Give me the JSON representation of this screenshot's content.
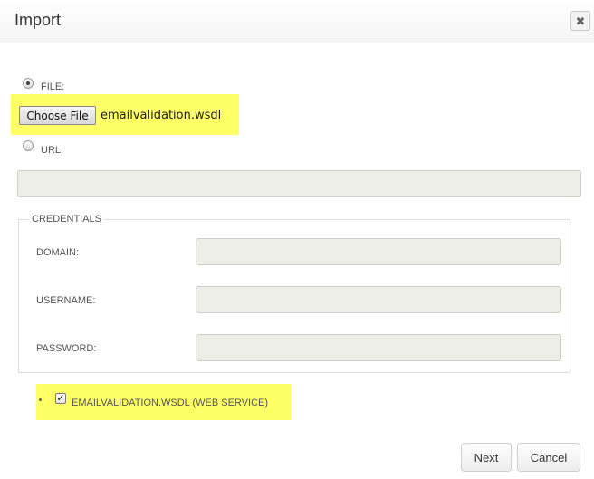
{
  "dialog": {
    "title": "Import",
    "close_icon": "close-icon"
  },
  "source": {
    "file_label": "FILE:",
    "file_selected": true,
    "choose_file_label": "Choose File",
    "file_name": "emailvalidation.wsdl",
    "url_label": "URL:",
    "url_value": ""
  },
  "credentials": {
    "legend": "CREDENTIALS",
    "domain_label": "DOMAIN:",
    "domain_value": "",
    "username_label": "USERNAME:",
    "username_value": "",
    "password_label": "PASSWORD:",
    "password_value": ""
  },
  "services": [
    {
      "label": "EMAILVALIDATION.WSDL (WEB SERVICE)",
      "checked": true
    }
  ],
  "footer": {
    "next_label": "Next",
    "cancel_label": "Cancel"
  },
  "colors": {
    "highlight": "#ffff66",
    "input_bg": "#eeeee8"
  }
}
